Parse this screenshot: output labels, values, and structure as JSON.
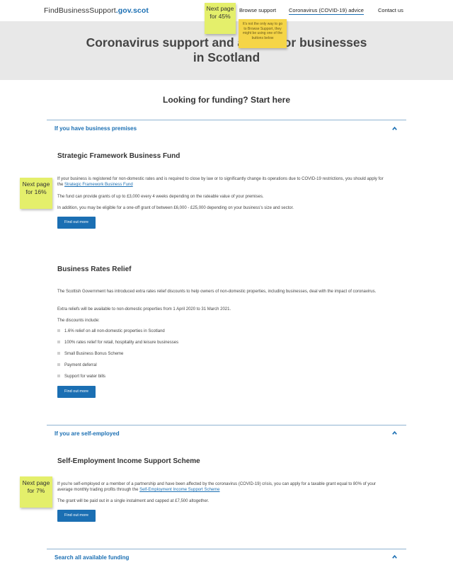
{
  "header": {
    "logo_main": "FindBusinessSupport",
    "logo_tld": ".gov.scot",
    "nav": [
      "Browse support",
      "Coronavirus (COVID-19) advice",
      "Contact us"
    ]
  },
  "hero": {
    "title": "Coronavirus support and advice for businesses in Scotland"
  },
  "funding_heading": "Looking for funding? Start here",
  "sections": {
    "premises": {
      "label": "If you have business premises",
      "card1": {
        "title": "Strategic Framework Business Fund",
        "p1_text": "If your business is registered for non-domestic rates and is required to close by law or to significantly change its operations due to COVID-19 restrictions, you should apply for the ",
        "p1_link": "Strategic Framework Business Fund",
        "p2": "The fund can provide grants of up to £3,000 every 4 weeks depending on the rateable value of your premises.",
        "p3": "In addition, you may be eligible for a one-off grant of between £6,000 - £25,000 depending on your business's size and sector.",
        "button": "Find out more"
      },
      "card2": {
        "title": "Business Rates Relief",
        "p1": "The Scottish Government has introduced extra rates relief discounts to help owners of non-domestic properties, including businesses, deal with the impact of coronavirus.",
        "p2": "Extra reliefs will be available to non-domestic properties from 1 April 2020 to 31 March 2021.",
        "p3": "The discounts include:",
        "bullets": [
          "1.6% relief on all non-domestic properties in Scotland",
          "100% rates relief for retail, hospitality and leisure businesses",
          "Small Business Bonus Scheme",
          "Payment deferral",
          "Support for water bills"
        ],
        "button": "Find out more"
      }
    },
    "self_employed": {
      "label": "If you are self-employed",
      "card": {
        "title": "Self-Employment Income Support Scheme",
        "p1_text": "If you're self-employed or a member of a partnership and have been affected by the coronavirus (COVID-19) crisis, you can apply for a taxable grant equal to 80% of your average monthly trading profits through the ",
        "p1_link": "Self-Employment Income Support Scheme",
        "p2": "The grant will be paid out in a single instalment and capped at £7,500 altogether.",
        "button": "Find out more"
      }
    },
    "search": {
      "label": "Search all available funding"
    }
  },
  "stickies": {
    "top": "Next page for 45%",
    "top_note": "It's not the only way to go to Browse Support, they might be using one of the buttons below",
    "mid": "Next page for 16%",
    "bottom": "Next page for 7%"
  },
  "colors": {
    "accent": "#1b6fb3",
    "hero_bg": "#e8e8e8",
    "sticky_green": "#e4ef6b",
    "sticky_yellow": "#f5d547"
  }
}
